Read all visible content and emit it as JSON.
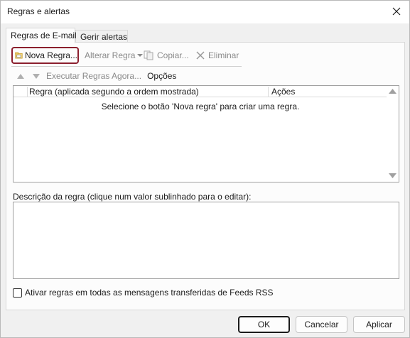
{
  "window": {
    "title": "Regras e alertas"
  },
  "tabs": [
    {
      "label": "Regras de E-mail",
      "active": true
    },
    {
      "label": "Gerir alertas",
      "active": false
    }
  ],
  "toolbar": {
    "new_rule": "Nova Regra...",
    "alter_rule": "Alterar Regra",
    "copy": "Copiar...",
    "delete": "Eliminar"
  },
  "secondary_toolbar": {
    "run_rules": "Executar Regras Agora...",
    "options": "Opções"
  },
  "rules_list": {
    "headers": [
      "Regra (aplicada segundo a ordem mostrada)",
      "Ações"
    ],
    "empty_message": "Selecione o botão 'Nova regra' para criar uma regra."
  },
  "description": {
    "label": "Descrição da regra (clique num valor sublinhado para o editar):"
  },
  "rss_checkbox": {
    "label": "Ativar regras em todas as mensagens transferidas de Feeds RSS",
    "checked": false
  },
  "buttons": {
    "ok": "OK",
    "cancel": "Cancelar",
    "apply": "Aplicar"
  },
  "colors": {
    "highlight_border": "#8b1f2e",
    "disabled_text": "#8a8a8a"
  }
}
